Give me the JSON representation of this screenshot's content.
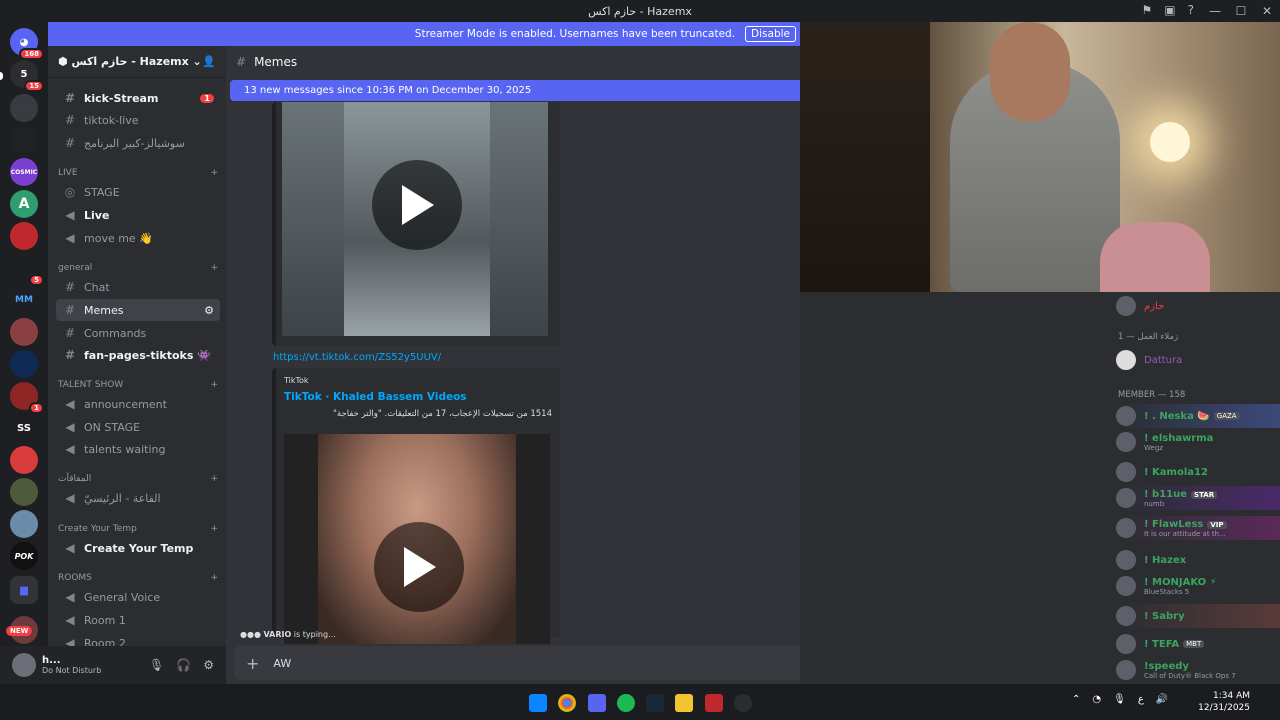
{
  "window": {
    "title": "حازم اكس - Hazemx",
    "minimize": "—",
    "maximize": "☐",
    "close": "✕"
  },
  "banner": {
    "text": "Streamer Mode is enabled. Usernames have been truncated.",
    "disable": "Disable"
  },
  "servers": [
    {
      "label": "168",
      "badge": "168"
    },
    {
      "label": "5",
      "badge": "15"
    },
    {
      "label": ""
    },
    {
      "label": ""
    },
    {
      "label": "COSMIC"
    },
    {
      "label": "A"
    },
    {
      "label": ""
    },
    {
      "label": "",
      "badge": "5"
    },
    {
      "label": "MM"
    },
    {
      "label": ""
    },
    {
      "label": ""
    },
    {
      "label": "",
      "badge": "1"
    },
    {
      "label": "SS"
    },
    {
      "label": ""
    },
    {
      "label": ""
    },
    {
      "label": ""
    },
    {
      "label": "POK"
    },
    {
      "label": ""
    },
    {
      "label": "NEW"
    }
  ],
  "guild": {
    "name": "حازم اكس - Hazemx"
  },
  "channels": [
    {
      "name": "kick-Stream",
      "type": "text",
      "bold": true,
      "badge": "1"
    },
    {
      "name": "tiktok-live",
      "type": "text"
    },
    {
      "name": "سوشيالز-كبير البرنامج",
      "type": "text"
    }
  ],
  "categories": {
    "live": "LIVE",
    "general": "general",
    "talent": "TALENT SHOW",
    "mafia": "المفاقآت",
    "temp": "Create Your Temp",
    "rooms": "ROOMS"
  },
  "live_channels": [
    "STAGE",
    "Live",
    "move me 👋"
  ],
  "general_channels": [
    "Chat",
    "Memes",
    "Commands",
    "fan-pages-tiktoks 👾"
  ],
  "talent_channels": [
    "announcement",
    "ON STAGE",
    "talents waiting"
  ],
  "mafia_channels": [
    "القاعة - الرئيسيّ"
  ],
  "temp_channels": [
    "Create Your Temp"
  ],
  "room_channels": [
    "General Voice",
    "Room 1",
    "Room 2"
  ],
  "user": {
    "name": "h...",
    "status": "Do Not Disturb"
  },
  "header": {
    "channel": "Memes"
  },
  "new_messages": "13 new messages since 10:36 PM on December 30, 2025",
  "message": {
    "link": "https://vt.tiktok.com/ZS52y5UUV/",
    "embed_provider": "TikTok",
    "embed_title": "TikTok · Khaled Bassem Videos",
    "embed_desc": "1514 من تسجيلات الإعجاب، 17 من التعليقات. \"والتر خفاجة\""
  },
  "typing": {
    "user": "VARIO",
    "text": " is typing..."
  },
  "composer": {
    "value": "AW"
  },
  "member_list": {
    "top_user": "حازم",
    "cat1": "زملاء العمل — 1",
    "cat1_user": "Dattura",
    "cat2": "MEMBER — 158",
    "members": [
      {
        "name": "! . Neska 🍉",
        "tag": "GAZA",
        "sub": ""
      },
      {
        "name": "! elshawrma",
        "sub": "Wegz"
      },
      {
        "name": "! Kamola12",
        "sub": ""
      },
      {
        "name": "! b11ue",
        "tag": "STAR",
        "sub": "numb"
      },
      {
        "name": "! FlawLess",
        "tag": "VIP",
        "sub": "It is our attitude at th..."
      },
      {
        "name": "! Hazex",
        "sub": ""
      },
      {
        "name": "! MONJAKO ⚡",
        "sub": "BlueStacks 5"
      },
      {
        "name": "! Sabry",
        "sub": ""
      },
      {
        "name": "! TEFA",
        "tag": "MBT",
        "sub": ""
      },
      {
        "name": "!speedy",
        "sub": "Call of Duty® Black Ops 7"
      }
    ]
  },
  "tray": {
    "time": "1:34 AM",
    "date": "12/31/2025",
    "lang": "ع"
  },
  "colors": {
    "accent": "#5865f2",
    "link": "#00a8fc",
    "online": "#3ba55d",
    "danger": "#f23f43"
  }
}
